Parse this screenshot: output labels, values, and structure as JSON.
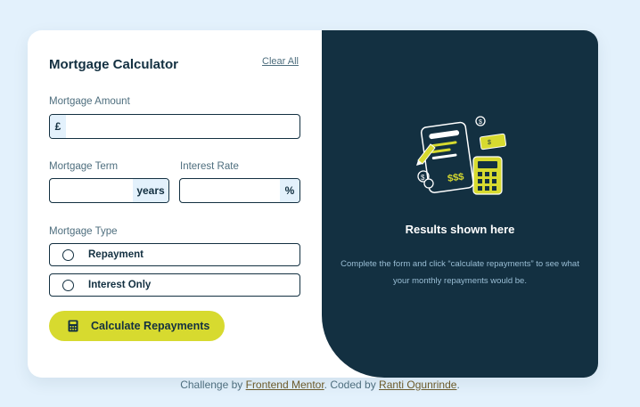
{
  "calculator": {
    "title": "Mortgage Calculator",
    "clear_label": "Clear All",
    "amount": {
      "label": "Mortgage Amount",
      "prefix": "£",
      "value": ""
    },
    "term": {
      "label": "Mortgage Term",
      "suffix": "years",
      "value": ""
    },
    "rate": {
      "label": "Interest Rate",
      "suffix": "%",
      "value": ""
    },
    "type": {
      "label": "Mortgage Type",
      "options": [
        {
          "label": "Repayment",
          "selected": false
        },
        {
          "label": "Interest Only",
          "selected": false
        }
      ]
    },
    "submit_label": "Calculate Repayments",
    "submit_icon": "calculator-icon"
  },
  "results": {
    "illustration": "empty-results-illustration",
    "title": "Results shown here",
    "description": "Complete the form and click “calculate repayments” to see what your monthly repayments would be."
  },
  "footer": {
    "prefix": "Challenge by ",
    "link1": "Frontend Mentor",
    "middle": ". Coded by ",
    "link2": "Ranti Ogunrinde",
    "suffix": "."
  },
  "colors": {
    "background": "#e3f1fc",
    "card": "#ffffff",
    "results_panel": "#133041",
    "accent_lime": "#d7da2f",
    "text_dark": "#133041",
    "text_muted": "#4e6e7e"
  }
}
